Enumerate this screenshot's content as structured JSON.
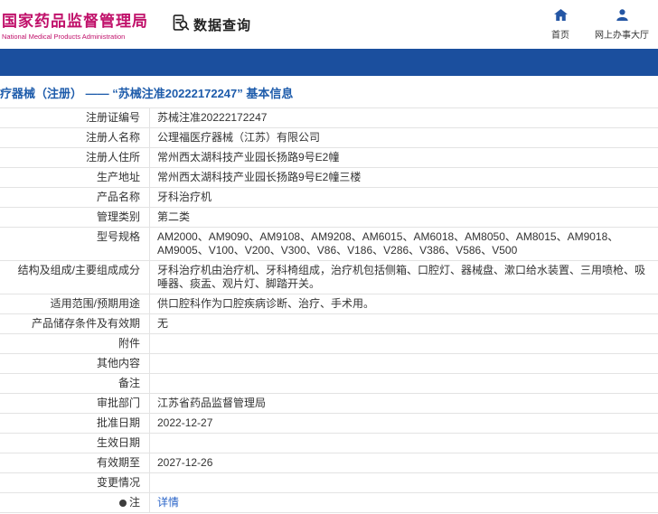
{
  "colors": {
    "brand": "#c0106a",
    "bar": "#1b4f9e",
    "title": "#1e5cab",
    "link": "#2a64c8",
    "iconblue": "#2456a4"
  },
  "header": {
    "logo_title": "国家药品监督管理局",
    "logo_subtitle": "National Medical Products Administration",
    "section_label": "数据查询",
    "nav": [
      {
        "icon": "home-icon",
        "label": "首页"
      },
      {
        "icon": "person-icon",
        "label": "网上办事大厅"
      }
    ]
  },
  "page": {
    "title": "疗器械（注册） —— “苏械注准20222172247” 基本信息"
  },
  "table": {
    "rows": [
      {
        "label": "注册证编号",
        "value": "苏械注准20222172247"
      },
      {
        "label": "注册人名称",
        "value": "公理福医疗器械（江苏）有限公司"
      },
      {
        "label": "注册人住所",
        "value": "常州西太湖科技产业园长扬路9号E2幢"
      },
      {
        "label": "生产地址",
        "value": "常州西太湖科技产业园长扬路9号E2幢三楼"
      },
      {
        "label": "产品名称",
        "value": "牙科治疗机"
      },
      {
        "label": "管理类别",
        "value": "第二类"
      },
      {
        "label": "型号规格",
        "value": "AM2000、AM9090、AM9108、AM9208、AM6015、AM6018、AM8050、AM8015、AM9018、AM9005、V100、V200、V300、V86、V186、V286、V386、V586、V500"
      },
      {
        "label": "结构及组成/主要组成成分",
        "value": "牙科治疗机由治疗机、牙科椅组成，治疗机包括侧箱、口腔灯、器械盘、漱口给水装置、三用喷枪、吸唾器、痰盂、观片灯、脚踏开关。"
      },
      {
        "label": "适用范围/预期用途",
        "value": "供口腔科作为口腔疾病诊断、治疗、手术用。"
      },
      {
        "label": "产品储存条件及有效期",
        "value": "无"
      },
      {
        "label": "附件",
        "value": ""
      },
      {
        "label": "其他内容",
        "value": ""
      },
      {
        "label": "备注",
        "value": ""
      },
      {
        "label": "审批部门",
        "value": "江苏省药品监督管理局"
      },
      {
        "label": "批准日期",
        "value": "2022-12-27"
      },
      {
        "label": "生效日期",
        "value": ""
      },
      {
        "label": "有效期至",
        "value": "2027-12-26"
      },
      {
        "label": "变更情况",
        "value": ""
      },
      {
        "label": "注",
        "icon": "note-dot",
        "value": "详情",
        "link": true
      }
    ]
  }
}
